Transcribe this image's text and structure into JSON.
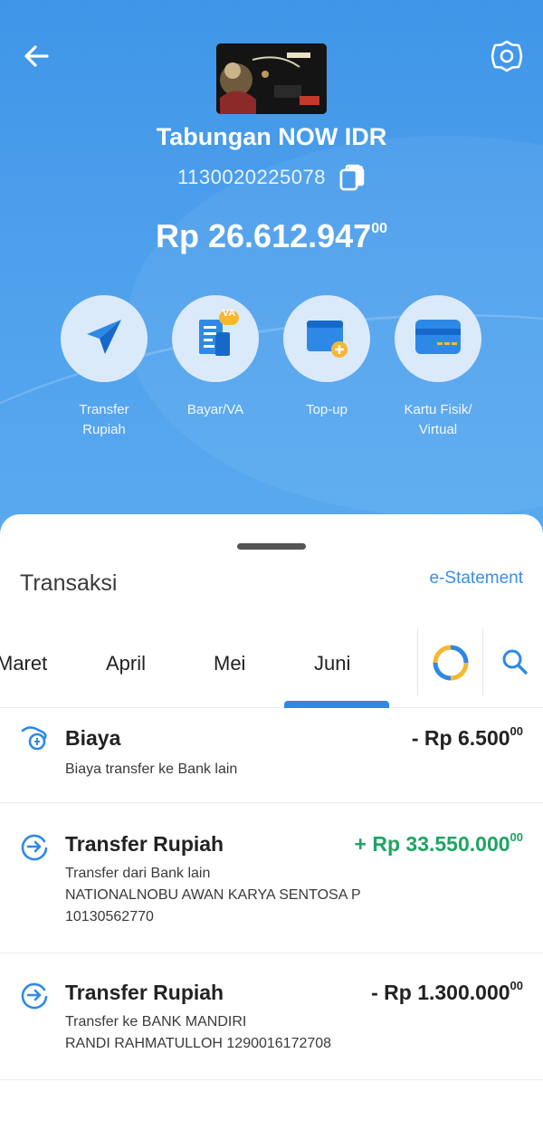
{
  "account": {
    "name": "Tabungan NOW IDR",
    "number": "1130020225078",
    "balance_main": "Rp 26.612.947",
    "balance_cents": "00"
  },
  "actions": [
    {
      "label": "Transfer\nRupiah",
      "icon": "paper-plane-icon"
    },
    {
      "label": "Bayar/VA",
      "icon": "bill-va-icon",
      "badge": "VA"
    },
    {
      "label": "Top-up",
      "icon": "wallet-plus-icon"
    },
    {
      "label": "Kartu Fisik/\nVirtual",
      "icon": "card-icon"
    }
  ],
  "transactions_section": {
    "title": "Transaksi",
    "estatement_label": "e-Statement"
  },
  "months": {
    "items": [
      "Maret",
      "April",
      "Mei",
      "Juni"
    ],
    "active": "Juni"
  },
  "transactions": [
    {
      "title": "Biaya",
      "amount": "- Rp 6.500",
      "cents": "00",
      "type": "debit",
      "description": "Biaya transfer ke Bank lain",
      "icon": "fee-icon"
    },
    {
      "title": "Transfer Rupiah",
      "amount": "+ Rp 33.550.000",
      "cents": "00",
      "type": "credit",
      "description": "Transfer dari Bank lain\nNATIONALNOBU AWAN KARYA SENTOSA P\n10130562770",
      "icon": "transfer-icon"
    },
    {
      "title": "Transfer Rupiah",
      "amount": "- Rp 1.300.000",
      "cents": "00",
      "type": "debit",
      "description": "Transfer ke BANK MANDIRI\nRANDI RAHMATULLOH 1290016172708",
      "icon": "transfer-icon"
    }
  ],
  "colors": {
    "header_blue": "#4a9de9",
    "accent_blue": "#2e89e6",
    "credit_green": "#1fa463"
  }
}
